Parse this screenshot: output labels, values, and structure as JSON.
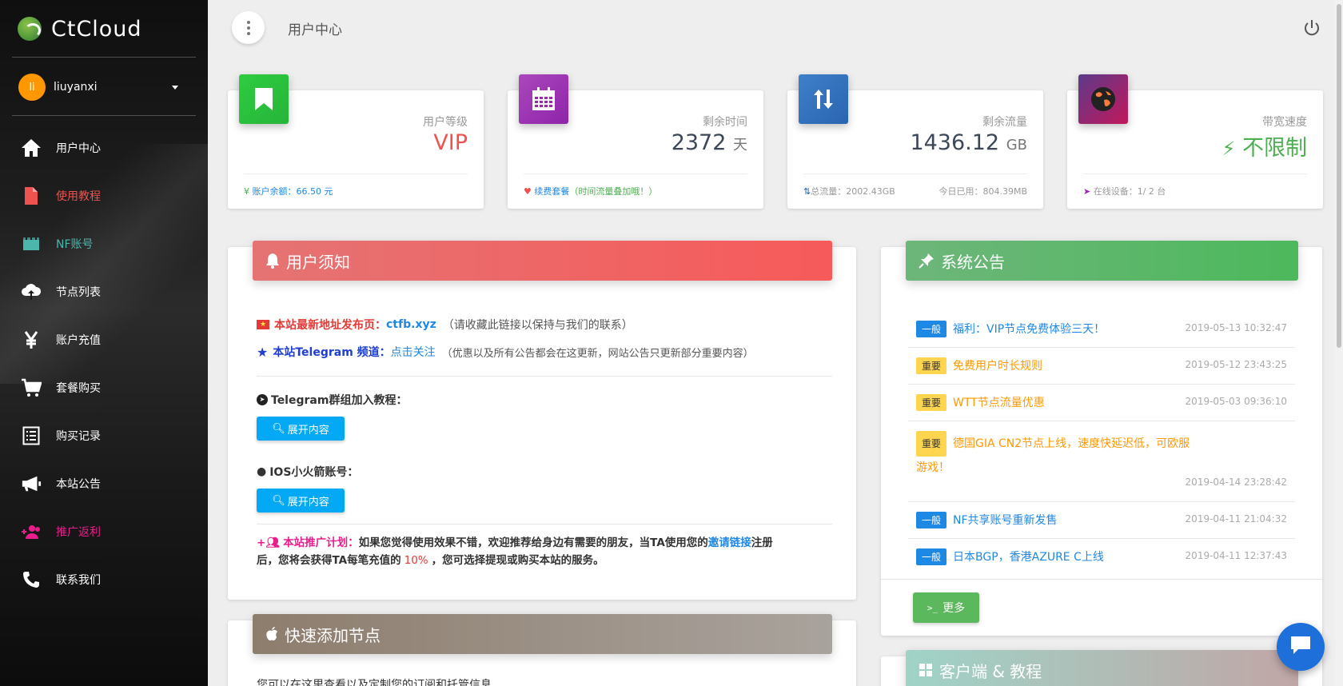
{
  "brand": {
    "name": "CtCloud"
  },
  "user": {
    "initials": "li",
    "name": "liuyanxi"
  },
  "menu": [
    {
      "label": "用户中心",
      "color": "#ffffff",
      "icon": "home-icon"
    },
    {
      "label": "使用教程",
      "color": "#ef5350",
      "icon": "document-icon"
    },
    {
      "label": "NF账号",
      "color": "#4db6ac",
      "icon": "film-icon"
    },
    {
      "label": "节点列表",
      "color": "#ffffff",
      "icon": "cloud-upload-icon"
    },
    {
      "label": "账户充值",
      "color": "#ffffff",
      "icon": "yen-icon"
    },
    {
      "label": "套餐购买",
      "color": "#ffffff",
      "icon": "cart-icon"
    },
    {
      "label": "购买记录",
      "color": "#ffffff",
      "icon": "list-icon"
    },
    {
      "label": "本站公告",
      "color": "#ffffff",
      "icon": "megaphone-icon"
    },
    {
      "label": "推广返利",
      "color": "#e91e8c",
      "icon": "users-icon"
    },
    {
      "label": "联系我们",
      "color": "#ffffff",
      "icon": "phone-icon"
    }
  ],
  "header": {
    "title": "用户中心"
  },
  "stats": {
    "level": {
      "label": "用户等级",
      "value": "VIP",
      "footer": "账户余额：66.50 元"
    },
    "time": {
      "label": "剩余时间",
      "value": "2372",
      "unit": "天",
      "footer_a": "续费套餐",
      "footer_b": "（时间流量叠加哦！）"
    },
    "traffic": {
      "label": "剩余流量",
      "value": "1436.12",
      "unit": "GB",
      "footer_left": "总流量：2002.43GB",
      "footer_right": "今日已用：804.39MB"
    },
    "bandwidth": {
      "label": "带宽速度",
      "value": "不限制",
      "footer": "在线设备：1/ 2 台"
    }
  },
  "notice": {
    "title": "用户须知",
    "line1_a": "本站最新地址发布页：",
    "line1_link": "ctfb.xyz",
    "line1_b": "（请收藏此链接以保持与我们的联系）",
    "line2_a": "本站Telegram 频道：",
    "line2_link": "点击关注",
    "line2_b": "（优惠以及所有公告都会在这更新，网站公告只更新部分重要内容）",
    "tg_title": "Telegram群组加入教程：",
    "expand": "展开内容",
    "ios_title": "IOS小火箭账号：",
    "promo_a": "+",
    "promo_b": "本站推广计划：",
    "promo_c": "如果您觉得使用效果不错，欢迎推荐给身边有需要的朋友，当TA使用您的",
    "promo_link": "邀请链接",
    "promo_d": "注册",
    "promo_e": "后，您将会获得TA每笔充值的",
    "promo_pct": "10%",
    "promo_f": "，您可选择提现或购买本站的服务。"
  },
  "quick": {
    "title": "快速添加节点",
    "text": "您可以在这里查看以及定制您的订阅和托管信息"
  },
  "announce": {
    "title": "系统公告",
    "items": [
      {
        "tag": "一般",
        "title": "福利：VIP节点免费体验三天！",
        "date": "2019-05-13 10:32:47"
      },
      {
        "tag": "重要",
        "title": "免费用户时长规则",
        "date": "2019-05-12 23:43:25"
      },
      {
        "tag": "重要",
        "title": "WTT节点流量优惠",
        "date": "2019-05-03 09:36:10"
      },
      {
        "tag": "重要",
        "title": "德国GIA CN2节点上线，速度快延迟低，可欧服游戏！",
        "date": "2019-04-14 23:28:42"
      },
      {
        "tag": "一般",
        "title": "NF共享账号重新发售",
        "date": "2019-04-11 21:04:32"
      },
      {
        "tag": "一般",
        "title": "日本BGP，香港AZURE C上线",
        "date": "2019-04-11 12:37:43"
      }
    ],
    "more": "更多",
    "more_prompt": ">_"
  },
  "client": {
    "title": "客户端 & 教程"
  }
}
